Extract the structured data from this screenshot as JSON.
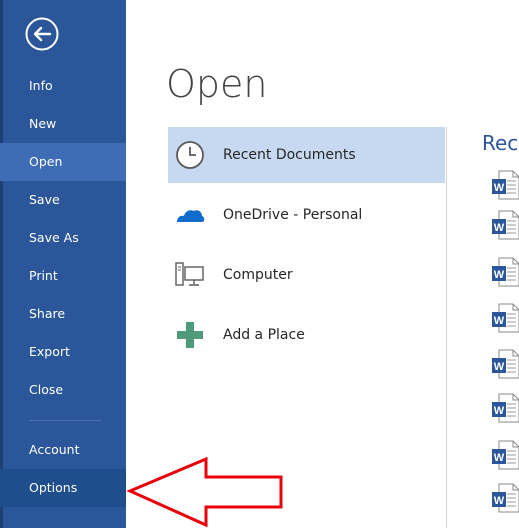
{
  "nav": {
    "items": [
      {
        "label": "Info"
      },
      {
        "label": "New"
      },
      {
        "label": "Open"
      },
      {
        "label": "Save"
      },
      {
        "label": "Save As"
      },
      {
        "label": "Print"
      },
      {
        "label": "Share"
      },
      {
        "label": "Export"
      },
      {
        "label": "Close"
      },
      {
        "label": "Account"
      },
      {
        "label": "Options"
      }
    ],
    "active_item": "Open",
    "back_icon": "back-arrow-icon"
  },
  "main": {
    "heading": "Open",
    "places": [
      {
        "label": "Recent Documents",
        "icon": "clock-icon",
        "selected": true
      },
      {
        "label": "OneDrive - Personal",
        "icon": "cloud-icon",
        "selected": false
      },
      {
        "label": "Computer",
        "icon": "computer-icon",
        "selected": false
      },
      {
        "label": "Add a Place",
        "icon": "plus-icon",
        "selected": false
      }
    ],
    "recent_title": "Rece",
    "recent_doc_icon": "word-document-icon"
  },
  "annotation": {
    "icon": "red-arrow-icon",
    "color": "#e8000b"
  },
  "colors": {
    "sidebar": "#2b579a",
    "active_nav": "#3e6db5",
    "selected_place": "#c7d9f1",
    "accent": "#2b579a"
  }
}
